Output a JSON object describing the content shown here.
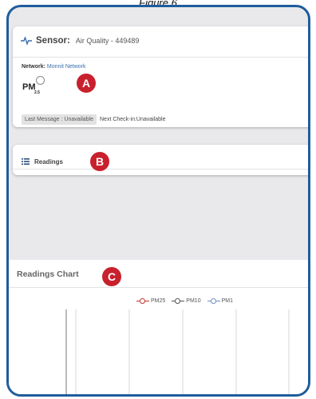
{
  "figure": {
    "caption": "Figure 6"
  },
  "sensor": {
    "prefix": "Sensor:",
    "name": "Air Quality - 449489",
    "network_label": "Network:",
    "network_value": "Monnit Network",
    "pm_label": "PM",
    "pm_sub": "2.5",
    "last_message": "Last Message : Unavailable",
    "next_checkin": "Next Check-in:Unavailable"
  },
  "readings": {
    "title": "Readings"
  },
  "chart": {
    "title": "Readings Chart"
  },
  "callouts": {
    "a": "A",
    "b": "B",
    "c": "C"
  },
  "chart_data": {
    "type": "line",
    "title": "",
    "series": [
      {
        "name": "PM25",
        "color": "#c0392b",
        "values": []
      },
      {
        "name": "PM10",
        "color": "#555555",
        "values": []
      },
      {
        "name": "PM1",
        "color": "#6d8fbf",
        "values": []
      }
    ],
    "legend": "top-right",
    "grid": true
  },
  "colors": {
    "frame": "#1f5d9c",
    "callout": "#c8202d",
    "link": "#3a6fb0"
  }
}
